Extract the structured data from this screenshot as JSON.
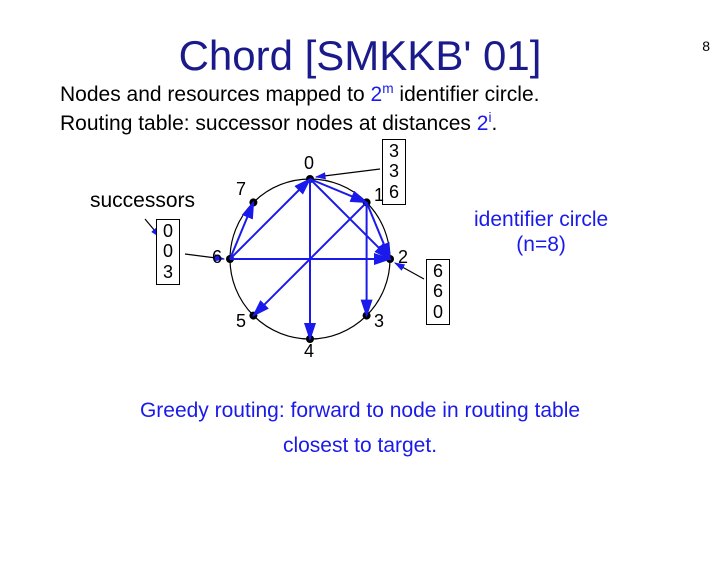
{
  "page_number": "8",
  "title": "Chord [SMKKB' 01]",
  "line1a": "Nodes and resources mapped to ",
  "line1b": " identifier circle.",
  "line2a": "Routing table: successor nodes at distances ",
  "line2b": ".",
  "two_m_base": "2",
  "two_m_exp": "m",
  "two_i_base": "2",
  "two_i_exp": "i",
  "successors_label": "successors",
  "succ_table": {
    "r0": "0",
    "r1": "0",
    "r2": "3"
  },
  "node_labels": {
    "n0": "0",
    "n1": "1",
    "n2": "2",
    "n3": "3",
    "n4": "4",
    "n5": "5",
    "n6": "6",
    "n7": "7"
  },
  "table_node0": {
    "r0": "3",
    "r1": "3",
    "r2": "6"
  },
  "table_node1": {
    "r0": "6",
    "r1": "6",
    "r2": "0"
  },
  "idcircle_line1": "identifier circle",
  "idcircle_line2": "(n=8)",
  "footer1": "Greedy routing: forward to node in routing table",
  "footer2": "closest to target.",
  "chart_data": {
    "type": "diagram",
    "n": 8,
    "active_nodes": [
      0,
      1,
      3,
      6
    ],
    "finger_tables": {
      "0": [
        3,
        3,
        6
      ],
      "1": [
        6,
        6,
        0
      ],
      "6": [
        0,
        0,
        3
      ]
    },
    "chords_from_6": [
      7,
      0,
      2
    ],
    "chords_from_0": [
      1,
      2,
      4
    ],
    "chords_from_1": [
      2,
      3,
      5
    ]
  }
}
